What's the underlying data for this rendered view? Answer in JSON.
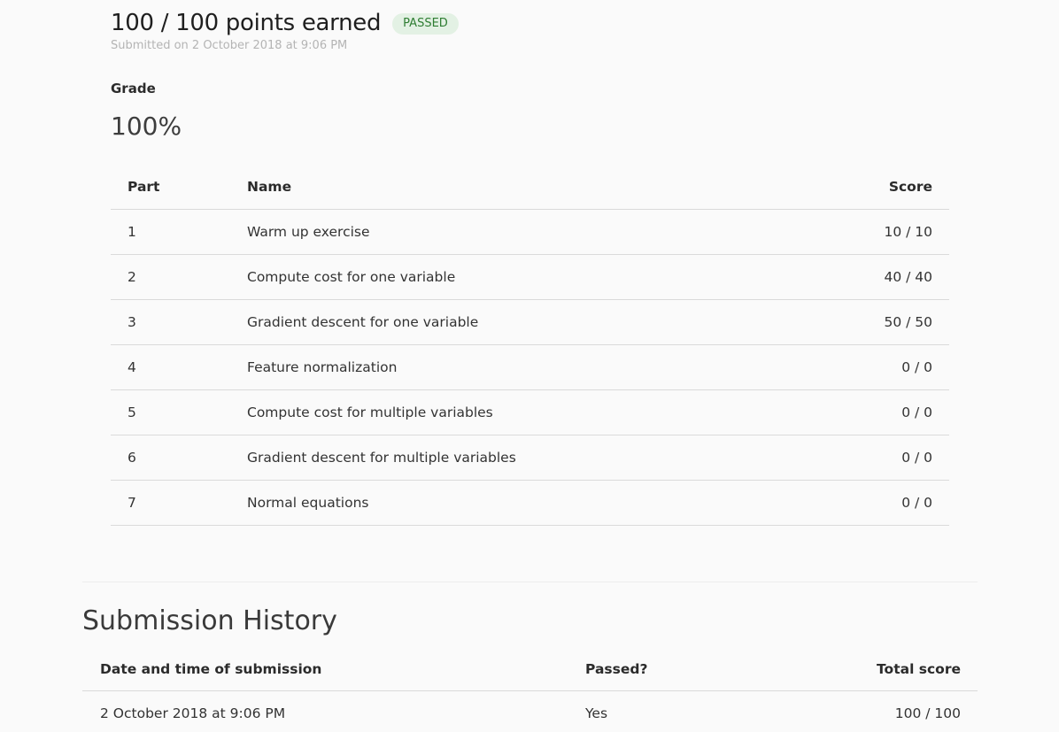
{
  "result": {
    "points": "100 / 100 points earned",
    "badge": "PASSED",
    "submitted": "Submitted on 2 October 2018 at 9:06 PM"
  },
  "grade": {
    "label": "Grade",
    "value": "100%"
  },
  "parts_table": {
    "headers": {
      "part": "Part",
      "name": "Name",
      "score": "Score"
    },
    "rows": [
      {
        "part": "1",
        "name": "Warm up exercise",
        "score": "10 / 10"
      },
      {
        "part": "2",
        "name": "Compute cost for one variable",
        "score": "40 / 40"
      },
      {
        "part": "3",
        "name": "Gradient descent for one variable",
        "score": "50 / 50"
      },
      {
        "part": "4",
        "name": "Feature normalization",
        "score": "0 / 0"
      },
      {
        "part": "5",
        "name": "Compute cost for multiple variables",
        "score": "0 / 0"
      },
      {
        "part": "6",
        "name": "Gradient descent for multiple variables",
        "score": "0 / 0"
      },
      {
        "part": "7",
        "name": "Normal equations",
        "score": "0 / 0"
      }
    ]
  },
  "history": {
    "title": "Submission History",
    "headers": {
      "date": "Date and time of submission",
      "passed": "Passed?",
      "total": "Total score"
    },
    "rows": [
      {
        "date": "2 October 2018 at 9:06 PM",
        "passed": "Yes",
        "total": "100 / 100"
      }
    ]
  },
  "colors": {
    "background": "#fafafa",
    "badge_bg": "#e3f1e4",
    "badge_text": "#2e7d32"
  }
}
